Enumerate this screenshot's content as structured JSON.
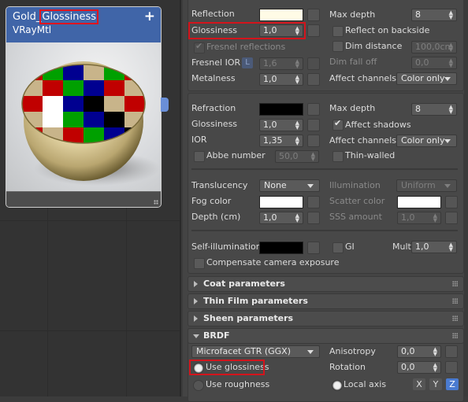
{
  "node": {
    "title_prefix": "Gold_",
    "title_highlight": "Glossiness",
    "subtitle": "VRayMtl",
    "add_icon": "plus-icon"
  },
  "reflection": {
    "reflection_label": "Reflection",
    "reflection_color": "#fffbe6",
    "glossiness_label": "Glossiness",
    "glossiness_value": "1,0",
    "fresnel_label": "Fresnel reflections",
    "fresnel_checked": true,
    "fresnel_ior_label": "Fresnel IOR",
    "fresnel_ior_lock": "L",
    "fresnel_ior_value": "1,6",
    "metalness_label": "Metalness",
    "metalness_value": "1,0",
    "max_depth_label": "Max depth",
    "max_depth_value": "8",
    "reflect_backside_label": "Reflect on backside",
    "dim_distance_label": "Dim distance",
    "dim_distance_value": "100,0cm",
    "dim_falloff_label": "Dim fall off",
    "dim_falloff_value": "0,0",
    "affect_channels_label": "Affect channels",
    "affect_channels_value": "Color only"
  },
  "refraction": {
    "refraction_label": "Refraction",
    "refraction_color": "#000000",
    "glossiness_label": "Glossiness",
    "glossiness_value": "1,0",
    "ior_label": "IOR",
    "ior_value": "1,35",
    "abbe_label": "Abbe number",
    "abbe_value": "50,0",
    "max_depth_label": "Max depth",
    "max_depth_value": "8",
    "affect_shadows_label": "Affect shadows",
    "affect_shadows_checked": true,
    "affect_channels_label": "Affect channels",
    "affect_channels_value": "Color only",
    "thin_walled_label": "Thin-walled"
  },
  "translucency": {
    "translucency_label": "Translucency",
    "translucency_value": "None",
    "fog_color_label": "Fog color",
    "fog_color": "#ffffff",
    "depth_label": "Depth (cm)",
    "depth_value": "1,0",
    "illumination_label": "Illumination",
    "illumination_value": "Uniform",
    "scatter_color_label": "Scatter color",
    "scatter_color": "#ffffff",
    "sss_amount_label": "SSS amount",
    "sss_amount_value": "1,0"
  },
  "self_illum": {
    "label": "Self-illumination",
    "color": "#000000",
    "gi_label": "GI",
    "mult_label": "Mult",
    "mult_value": "1,0",
    "compensate_label": "Compensate camera exposure"
  },
  "rollouts": [
    {
      "title": "Coat parameters",
      "open": false
    },
    {
      "title": "Thin Film parameters",
      "open": false
    },
    {
      "title": "Sheen parameters",
      "open": false
    },
    {
      "title": "BRDF",
      "open": true
    }
  ],
  "brdf": {
    "type_value": "Microfacet GTR (GGX)",
    "use_glossiness_label": "Use glossiness",
    "use_roughness_label": "Use roughness",
    "selected": "Use glossiness",
    "anisotropy_label": "Anisotropy",
    "anisotropy_value": "0,0",
    "rotation_label": "Rotation",
    "rotation_value": "0,0",
    "local_axis_label": "Local axis",
    "axes": [
      "X",
      "Y",
      "Z"
    ],
    "active_axis": "Z"
  }
}
